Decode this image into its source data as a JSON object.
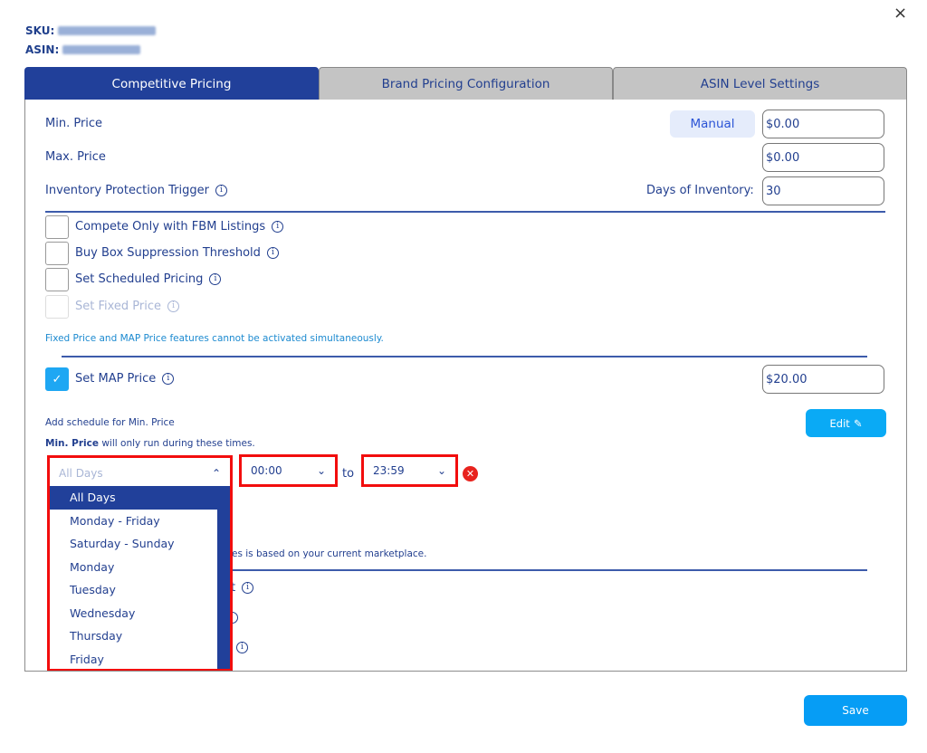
{
  "header": {
    "close_icon": "×",
    "sku_label": "SKU:",
    "asin_label": "ASIN:"
  },
  "tabs": [
    {
      "label": "Competitive Pricing",
      "active": true
    },
    {
      "label": "Brand Pricing Configuration",
      "active": false
    },
    {
      "label": "ASIN Level Settings",
      "active": false
    }
  ],
  "pricing": {
    "min_price_label": "Min. Price",
    "min_price_mode": "Manual",
    "min_price_value": "$0.00",
    "max_price_label": "Max. Price",
    "max_price_value": "$0.00",
    "inventory_trigger_label": "Inventory Protection Trigger",
    "days_of_inventory_label": "Days of Inventory:",
    "days_of_inventory_value": "30"
  },
  "options": [
    {
      "label": "Compete Only with FBM Listings",
      "checked": false,
      "disabled": false
    },
    {
      "label": "Buy Box Suppression Threshold",
      "checked": false,
      "disabled": false
    },
    {
      "label": "Set Scheduled Pricing",
      "checked": false,
      "disabled": false
    },
    {
      "label": "Set Fixed Price",
      "checked": false,
      "disabled": true
    }
  ],
  "fixed_map_note": "Fixed Price and MAP Price features cannot be activated simultaneously.",
  "map_price": {
    "label": "Set MAP Price",
    "checked": true,
    "check_glyph": "✓",
    "value": "$20.00"
  },
  "schedule": {
    "add_label": "Add schedule for Min. Price",
    "edit_label": "Edit",
    "edit_icon": "✎",
    "run_note_bold": "Min. Price",
    "run_note_rest": " will only run during these times.",
    "days_select_value": "All Days",
    "start_time": "00:00",
    "to_label": "to",
    "end_time": "23:59",
    "timezone_note_partial": "es is based on your current marketplace.",
    "chevron_up": "⌃",
    "chevron_down": "⌄",
    "remove_icon": "✕"
  },
  "hidden_rows_partial": [
    "t",
    "",
    ""
  ],
  "days_dropdown": {
    "options": [
      "All Days",
      "Monday - Friday",
      "Saturday - Sunday",
      "Monday",
      "Tuesday",
      "Wednesday",
      "Thursday",
      "Friday"
    ],
    "selected": "All Days"
  },
  "footer": {
    "save_label": "Save"
  },
  "colors": {
    "primary": "#21409a",
    "accent": "#0aaaf5",
    "highlight": "#f20d0d",
    "danger": "#e8231e"
  }
}
